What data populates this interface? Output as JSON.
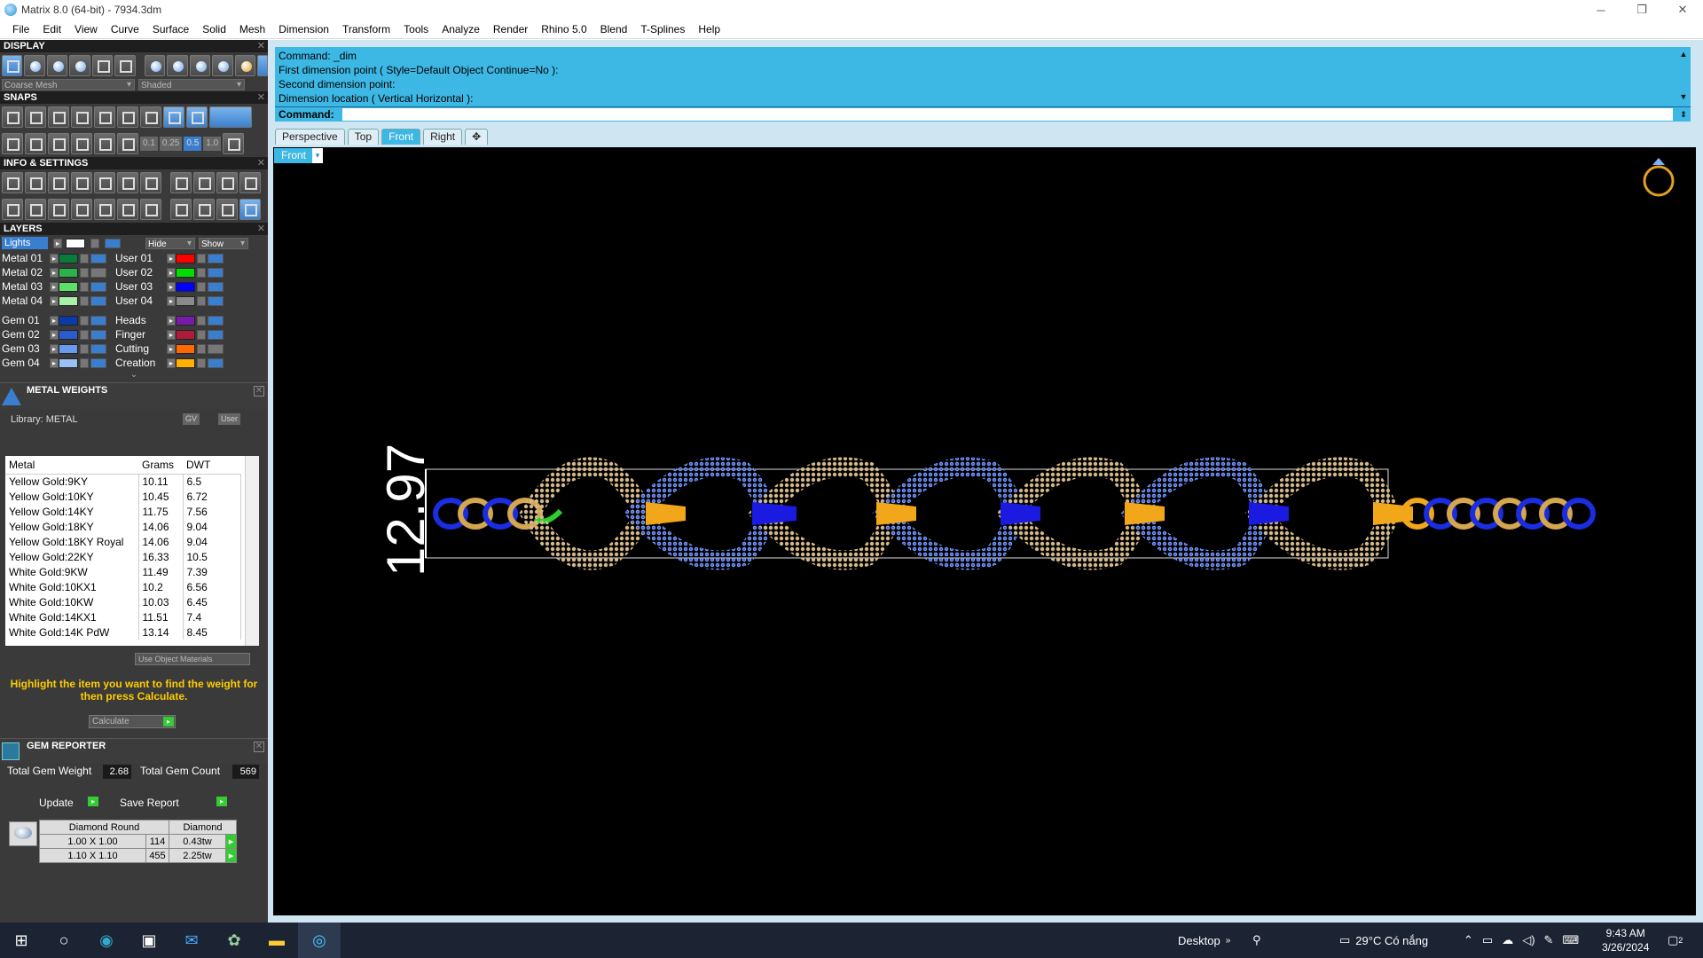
{
  "window": {
    "title": "Matrix 8.0 (64-bit) - 7934.3dm"
  },
  "menu": [
    "File",
    "Edit",
    "View",
    "Curve",
    "Surface",
    "Solid",
    "Mesh",
    "Dimension",
    "Transform",
    "Tools",
    "Analyze",
    "Render",
    "Rhino 5.0",
    "Blend",
    "T-Splines",
    "Help"
  ],
  "display": {
    "header": "DISPLAY",
    "mesh_mode": "Coarse Mesh",
    "shade_mode": "Shaded"
  },
  "snaps": {
    "header": "SNAPS",
    "values": [
      "0.1",
      "0.25",
      "0.5",
      "1.0"
    ]
  },
  "info": {
    "header": "INFO & SETTINGS"
  },
  "layers": {
    "header": "LAYERS",
    "lights": "Lights",
    "hide": "Hide",
    "show": "Show",
    "left": [
      {
        "name": "Metal 01",
        "color": "#0a7a3a"
      },
      {
        "name": "Metal 02",
        "color": "#2bb24b"
      },
      {
        "name": "Metal 03",
        "color": "#5be06a"
      },
      {
        "name": "Metal 04",
        "color": "#a8f0a8"
      },
      {
        "name": "Gem 01",
        "color": "#0a3aa8"
      },
      {
        "name": "Gem 02",
        "color": "#2a5cd0"
      },
      {
        "name": "Gem 03",
        "color": "#6a9af0"
      },
      {
        "name": "Gem 04",
        "color": "#9ac0f5"
      }
    ],
    "right": [
      {
        "name": "User 01",
        "color": "#ff0000"
      },
      {
        "name": "User 02",
        "color": "#00e000"
      },
      {
        "name": "User 03",
        "color": "#0000ff"
      },
      {
        "name": "User 04",
        "color": "#8a8a8a"
      },
      {
        "name": "Heads",
        "color": "#7a1aa8"
      },
      {
        "name": "Finger",
        "color": "#b01a3a"
      },
      {
        "name": "Cutting",
        "color": "#ff6a00"
      },
      {
        "name": "Creation",
        "color": "#ffb000"
      }
    ]
  },
  "metal_weights": {
    "header": "METAL WEIGHTS",
    "library": "Library: METAL",
    "gv": "GV",
    "user": "User",
    "columns": [
      "Metal",
      "Grams",
      "DWT"
    ],
    "rows": [
      [
        "Yellow Gold:9KY",
        "10.11",
        "6.5"
      ],
      [
        "Yellow Gold:10KY",
        "10.45",
        "6.72"
      ],
      [
        "Yellow Gold:14KY",
        "11.75",
        "7.56"
      ],
      [
        "Yellow Gold:18KY",
        "14.06",
        "9.04"
      ],
      [
        "Yellow Gold:18KY Royal",
        "14.06",
        "9.04"
      ],
      [
        "Yellow Gold:22KY",
        "16.33",
        "10.5"
      ],
      [
        "White Gold:9KW",
        "11.49",
        "7.39"
      ],
      [
        "White Gold:10KX1",
        "10.2",
        "6.56"
      ],
      [
        "White Gold:10KW",
        "10.03",
        "6.45"
      ],
      [
        "White Gold:14KX1",
        "11.51",
        "7.4"
      ],
      [
        "White Gold:14K PdW",
        "13.14",
        "8.45"
      ]
    ],
    "use_object_materials": "Use Object Materials",
    "hint": "Highlight the item you want to find the weight for then press Calculate.",
    "calculate": "Calculate"
  },
  "gem_reporter": {
    "header": "GEM REPORTER",
    "total_weight_label": "Total Gem Weight",
    "total_weight": "2.68",
    "total_count_label": "Total Gem Count",
    "total_count": "569",
    "update": "Update",
    "save_report": "Save Report",
    "table_headers": [
      "Diamond Round",
      "Diamond"
    ],
    "rows": [
      [
        "1.00 X 1.00",
        "114",
        "0.43tw"
      ],
      [
        "1.10 X 1.10",
        "455",
        "2.25tw"
      ]
    ]
  },
  "command": {
    "history": [
      "Command: _dim",
      "First dimension point ( Style=Default  Object  Continue=No ):",
      "Second dimension point:",
      "Dimension location ( Vertical  Horizontal ):"
    ],
    "prompt": "Command:"
  },
  "viewport": {
    "tabs": [
      "Perspective",
      "Top",
      "Front",
      "Right"
    ],
    "active_tab": "Front",
    "label": "Front",
    "dimension_text": "12.97"
  },
  "taskbar": {
    "desktop": "Desktop",
    "weather": "29°C  Có nắng",
    "time": "9:43 AM",
    "date": "3/26/2024",
    "notifications": "2"
  }
}
